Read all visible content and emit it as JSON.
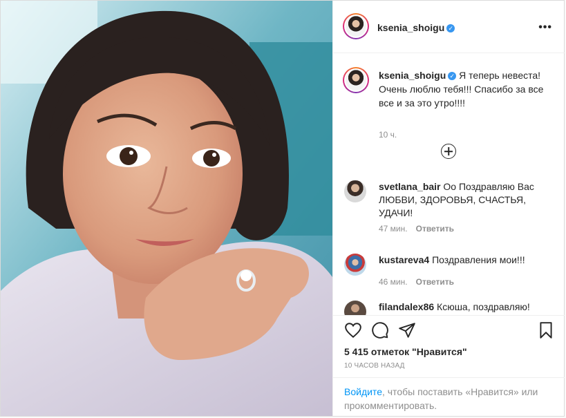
{
  "author": {
    "username": "ksenia_shoigu",
    "verified_icon": "verified-badge-icon"
  },
  "header": {
    "more_label": "•••"
  },
  "caption": {
    "text": "Я теперь невеста! Очень люблю тебя!!! Спасибо за все все и за это утро!!!!",
    "time": "10 ч."
  },
  "comments": [
    {
      "username": "svetlana_bair",
      "text": "Оо Поздравляю Вас ЛЮБВИ, ЗДОРОВЬЯ, СЧАСТЬЯ, УДАЧИ!",
      "time": "47 мин.",
      "reply": "Ответить"
    },
    {
      "username": "kustareva4",
      "text": "Поздравления мои!!!",
      "time": "46 мин.",
      "reply": "Ответить"
    },
    {
      "username": "filandalex86",
      "text": "Ксюша, поздравляю!",
      "time": "",
      "reply": ""
    }
  ],
  "actions": {
    "icons": [
      "heart-icon",
      "comment-icon",
      "share-icon",
      "bookmark-icon"
    ],
    "likes": "5 415 отметок \"Нравится\"",
    "posted_ago": "10 ЧАСОВ НАЗАД"
  },
  "login_prompt": {
    "link": "Войдите",
    "text": ", чтобы поставить «Нравится» или прокомментировать."
  },
  "colors": {
    "accent": "#0095f6",
    "verified": "#3897f0",
    "text": "#262626",
    "muted": "#8e8e8e",
    "border": "#efefef"
  }
}
